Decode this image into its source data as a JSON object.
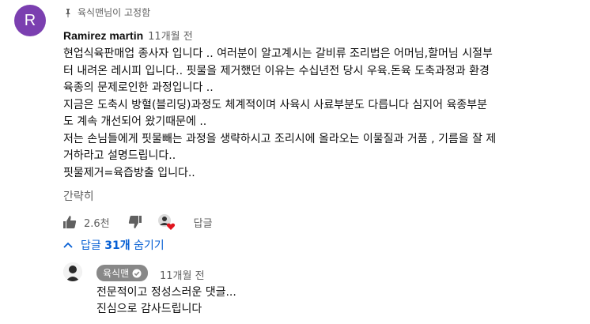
{
  "pinned": {
    "icon": "pin-icon",
    "text": "육식맨님이 고정함"
  },
  "comment": {
    "avatar_letter": "R",
    "avatar_color": "#7b3fb0",
    "author": "Ramirez martin",
    "time": "11개월 전",
    "lines": [
      "현업식육판매업 종사자 입니다 .. 여러분이 알고계시는 갈비류 조리법은 어머님,할머님 시절부",
      "터 내려온 레시피 입니다.. 핏물을 제거했던 이유는 수십년전 당시 우육.돈육 도축과정과 환경",
      "육종의 문제로인한 과정입니다 ..",
      "지금은 도축시 방혈(블리딩)과정도 체계적이며 사육시 사료부분도 다릅니다 심지어 육종부분",
      "도 계속 개선되어 왔기때문에 ..",
      "저는 손님들에게 핏물빼는 과정을 생략하시고 조리시에 올라오는 이물질과 거품 , 기름을 잘 제",
      "거하라고 설명드립니다..",
      "핏물제거=육즙방출 입니다.."
    ],
    "show_less": "간략히",
    "like_count": "2.6천",
    "reply_label": "답글"
  },
  "replies_toggle": {
    "prefix": "답글 ",
    "count": "31개",
    "suffix": " 숨기기"
  },
  "reply": {
    "author": "육식맨",
    "time": "11개월 전",
    "lines": [
      "전문적이고 정성스러운 댓글...",
      "진심으로 감사드립니다"
    ]
  }
}
